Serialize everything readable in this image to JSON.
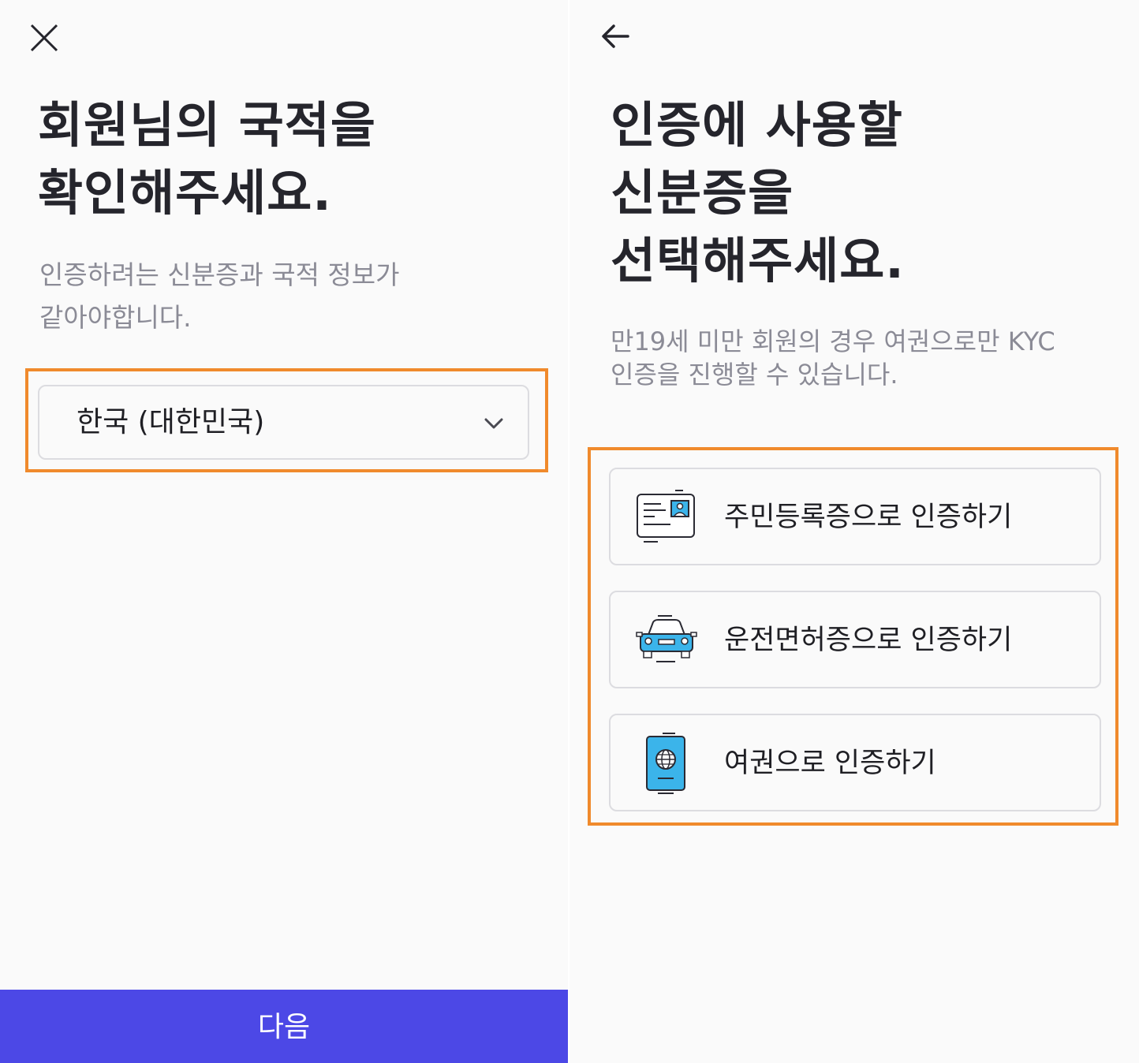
{
  "left_screen": {
    "title_lines": [
      "회원님의 국적을",
      "확인해주세요."
    ],
    "subtitle_lines": [
      "인증하려는 신분증과 국적 정보가",
      "같아야합니다."
    ],
    "nationality_select": {
      "value": "한국 (대한민국)"
    },
    "next_button_label": "다음"
  },
  "right_screen": {
    "title_lines": [
      "인증에 사용할",
      "신분증을",
      "선택해주세요."
    ],
    "subtitle_lines": [
      "만19세 미만 회원의 경우 여권으로만 KYC",
      "인증을 진행할 수 있습니다."
    ],
    "options": [
      {
        "label": "주민등록증으로 인증하기",
        "icon": "id-card-icon"
      },
      {
        "label": "운전면허증으로 인증하기",
        "icon": "car-icon"
      },
      {
        "label": "여권으로 인증하기",
        "icon": "passport-icon"
      }
    ]
  },
  "colors": {
    "highlight": "#f08a2c",
    "primary_button": "#4c48e6",
    "icon_blue": "#3bb4ea",
    "title_text": "#25252c",
    "subtitle_text": "#8b8b96"
  }
}
